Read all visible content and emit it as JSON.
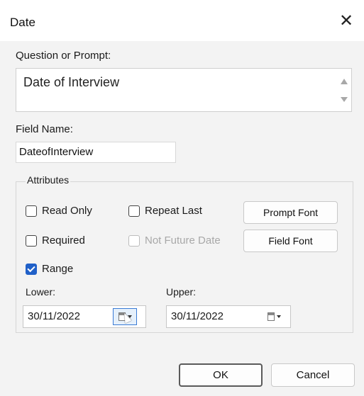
{
  "window": {
    "title": "Date",
    "close_icon": "close-icon"
  },
  "prompt": {
    "label": "Question or Prompt:",
    "value": "Date of Interview"
  },
  "field_name": {
    "label": "Field Name:",
    "value": "DateofInterview"
  },
  "attributes": {
    "title": "Attributes",
    "read_only": {
      "label": "Read Only",
      "checked": false
    },
    "repeat_last": {
      "label": "Repeat Last",
      "checked": false
    },
    "required": {
      "label": "Required",
      "checked": false
    },
    "not_future_date": {
      "label": "Not Future Date",
      "checked": false,
      "enabled": false
    },
    "range": {
      "label": "Range",
      "checked": true
    },
    "prompt_font_button": "Prompt Font",
    "field_font_button": "Field Font",
    "lower": {
      "label": "Lower:",
      "value": "30/11/2022"
    },
    "upper": {
      "label": "Upper:",
      "value": "30/11/2022"
    }
  },
  "buttons": {
    "ok": "OK",
    "cancel": "Cancel"
  },
  "colors": {
    "accent": "#2060c8",
    "dialog_bg": "#f3f3f3",
    "disabled_text": "#a8a8a8"
  }
}
